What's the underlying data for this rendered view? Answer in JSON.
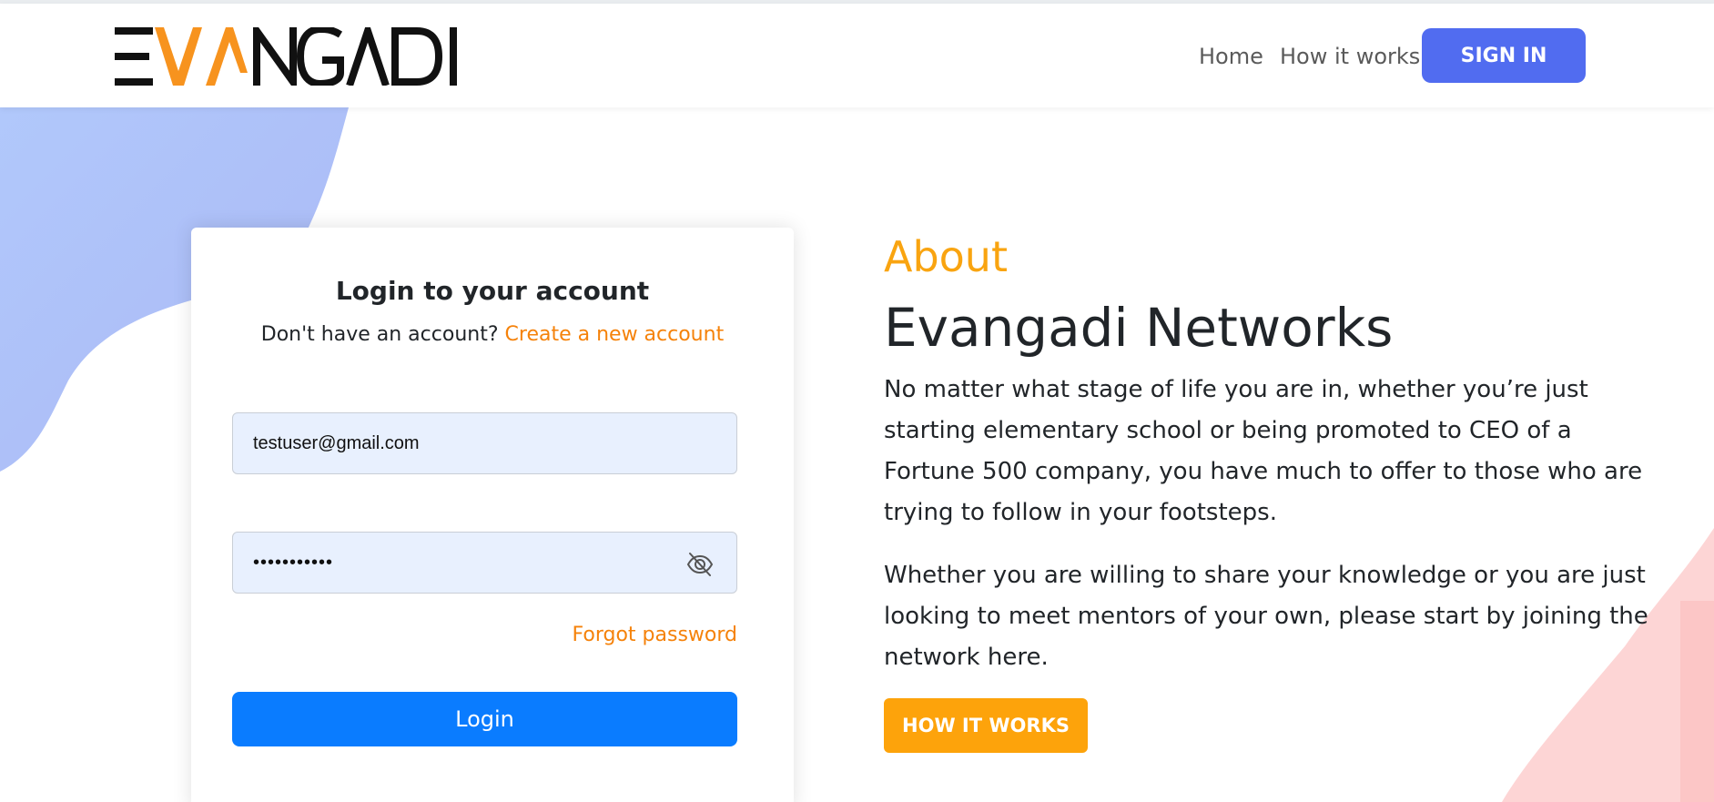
{
  "brand": {
    "logo_text": "EVANGADI",
    "colors": {
      "black": "#111111",
      "orange": "#f7931e"
    }
  },
  "nav": {
    "home": "Home",
    "how_it_works": "How it works",
    "sign_in": "SIGN IN"
  },
  "login": {
    "title": "Login to your account",
    "no_account_text": "Don't have an account?",
    "create_account_link": "Create a new account",
    "email_value": "testuser@gmail.com",
    "password_value": "•••••••••••",
    "password_visibility_icon": "eye-slash-icon",
    "forgot_password": "Forgot password",
    "login_button": "Login"
  },
  "about": {
    "label": "About",
    "title": "Evangadi Networks",
    "paragraph_1": "No matter what stage of life you are in, whether you’re just starting elementary school or being promoted to CEO of a Fortune 500 company, you have much to offer to those who are trying to follow in your footsteps.",
    "paragraph_2": "Whether you are willing to share your knowledge or you are just looking to meet mentors of your own, please start by joining the network here.",
    "how_it_works_button": "HOW IT WORKS"
  },
  "theme": {
    "accent_blue": "#516cf0",
    "login_blue": "#0a7cff",
    "link_orange": "#f5820a",
    "about_orange": "#f9a410",
    "button_orange": "#fda30b",
    "input_bg": "#e8f0fe"
  }
}
